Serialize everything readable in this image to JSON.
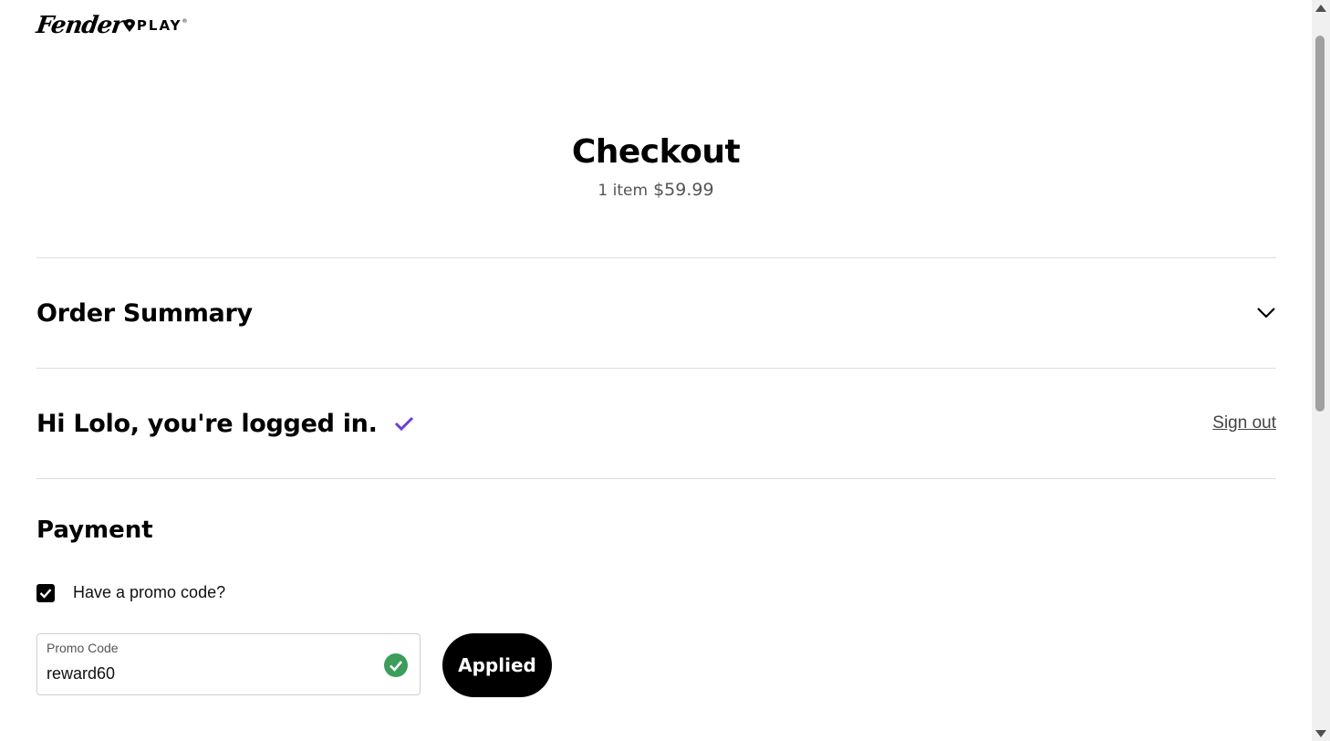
{
  "logo": {
    "script_text": "Fender",
    "play_text": "PLAY",
    "reg_mark": "®"
  },
  "header": {
    "title": "Checkout",
    "item_count": "1 item",
    "total": "$59.99"
  },
  "order_summary": {
    "title": "Order Summary",
    "toggle_icon": "chevron-down-icon"
  },
  "login": {
    "greeting": "Hi Lolo, you're logged in.",
    "check_icon": "checkmark-icon",
    "check_color": "#6a3fd6",
    "sign_out_label": "Sign out"
  },
  "payment": {
    "title": "Payment",
    "promo_checkbox_label": "Have a promo code?",
    "promo_checked": true,
    "promo_field_label": "Promo Code",
    "promo_field_value": "reward60",
    "valid_icon": "check-circle-icon",
    "valid_color": "#3c9d5d",
    "applied_button_label": "Applied"
  },
  "colors": {
    "divider": "#dddddd",
    "button_bg": "#000000",
    "button_text": "#ffffff"
  }
}
